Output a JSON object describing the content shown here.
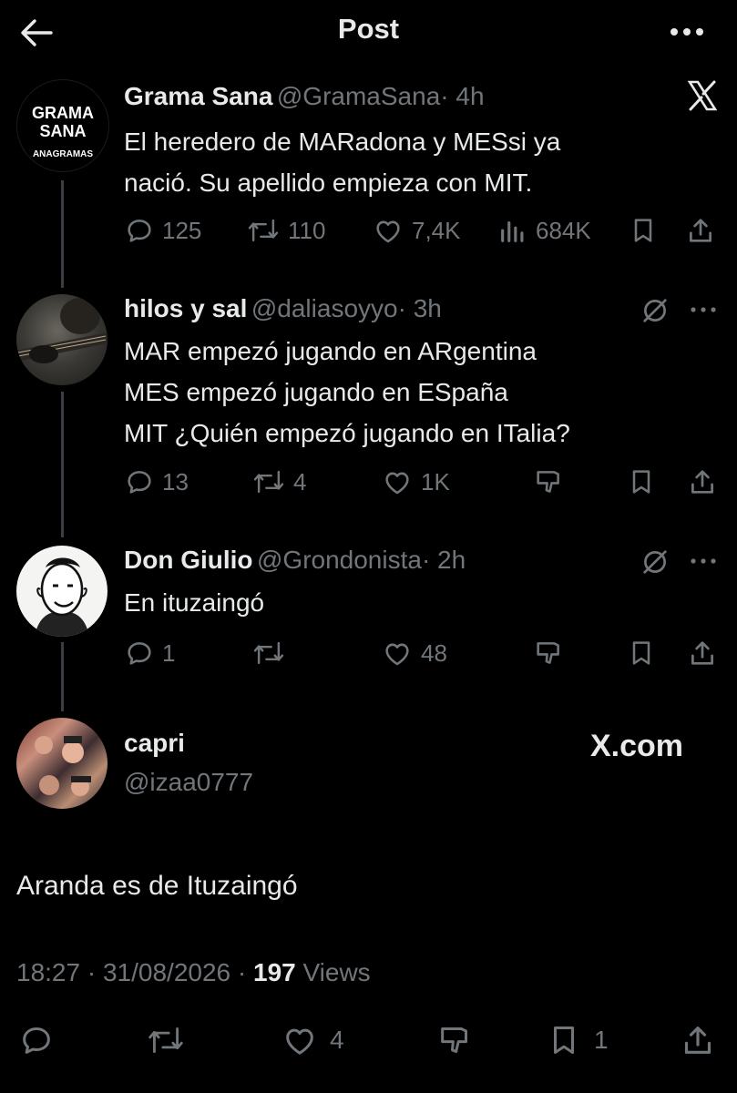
{
  "header": {
    "title": "Post"
  },
  "tweets": [
    {
      "avatar_text": [
        "GRAMA",
        "SANA",
        "ANAGRAMAS"
      ],
      "name": "Grama Sana",
      "handle": "@GramaSana",
      "time": "· 4h",
      "lines": [
        "El heredero de MARadona y MESsi ya",
        "nació. Su apellido empieza con MIT."
      ],
      "stats": {
        "replies": "125",
        "retweets": "110",
        "likes": "7,4K",
        "views": "684K"
      }
    },
    {
      "name": "hilos y sal",
      "handle": "@daliasoyyo",
      "time": "· 3h",
      "lines": [
        "MAR empezó jugando en ARgentina",
        "MES empezó jugando en ESpaña",
        "MIT ¿Quién empezó jugando en ITalia?"
      ],
      "stats": {
        "replies": "13",
        "retweets": "4",
        "likes": "1K"
      }
    },
    {
      "name": "Don Giulio",
      "handle": "@Grondonista",
      "time": "· 2h",
      "lines": [
        "En ituzaingó"
      ],
      "stats": {
        "replies": "1",
        "retweets": "",
        "likes": "48"
      }
    }
  ],
  "main_post": {
    "name": "capri",
    "handle": "@izaa0777",
    "watermark": "X.com",
    "text": "Aranda es de Ituzaingó",
    "time": "18:27",
    "date": "31/08/2026",
    "views_count": "197",
    "views_label": "Views",
    "stats": {
      "likes": "4",
      "bookmarks": "1"
    }
  },
  "icons": [
    "back-arrow-icon",
    "more-icon",
    "x-logo-icon",
    "reply-icon",
    "retweet-icon",
    "like-icon",
    "views-icon",
    "bookmark-icon",
    "share-icon",
    "grok-icon",
    "dislike-icon"
  ]
}
